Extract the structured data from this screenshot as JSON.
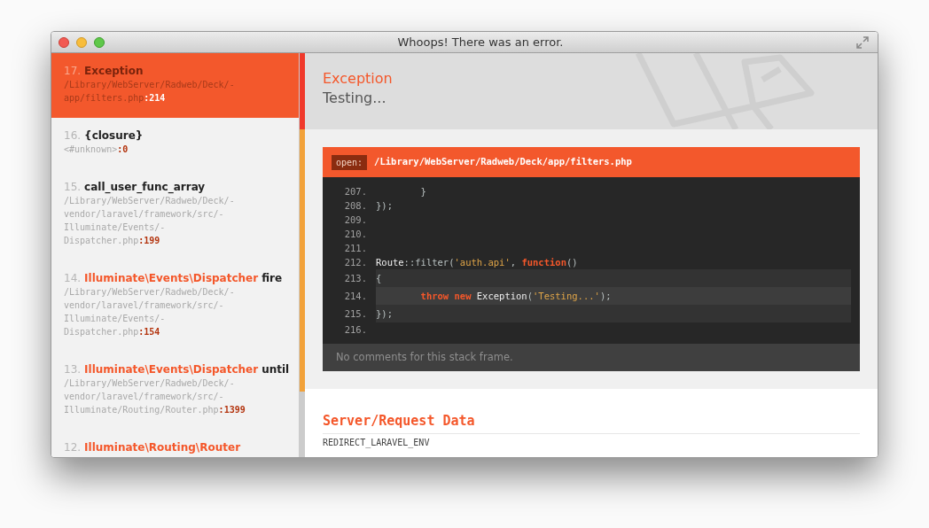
{
  "window": {
    "title": "Whoops! There was an error."
  },
  "frames": [
    {
      "number": "17.",
      "method": "Exception",
      "file": [
        "/Library/WebServer/Radweb/Deck/-",
        "app/filters.php"
      ],
      "line": ":214",
      "selected": true
    },
    {
      "number": "16.",
      "method": "{closure}",
      "file": [
        "<#unknown>"
      ],
      "line": ":0",
      "selected": false
    },
    {
      "number": "15.",
      "method": "call_user_func_array",
      "file": [
        "/Library/WebServer/Radweb/Deck/-",
        "vendor/laravel/framework/src/-",
        "Illuminate/Events/-",
        "Dispatcher.php"
      ],
      "line": ":199",
      "selected": false
    },
    {
      "number": "14.",
      "class": "Illuminate\\Events\\Dispatcher",
      "method": "fire",
      "file": [
        "/Library/WebServer/Radweb/Deck/-",
        "vendor/laravel/framework/src/-",
        "Illuminate/Events/-",
        "Dispatcher.php"
      ],
      "line": ":154",
      "selected": false
    },
    {
      "number": "13.",
      "class": "Illuminate\\Events\\Dispatcher",
      "method": "until",
      "file": [
        "/Library/WebServer/Radweb/Deck/-",
        "vendor/laravel/framework/src/-",
        "Illuminate/Routing/Router.php"
      ],
      "line": ":1399",
      "selected": false
    },
    {
      "number": "12.",
      "class": "Illuminate\\Routing\\Router",
      "selected": false
    }
  ],
  "exception": {
    "type": "Exception",
    "message": "Testing..."
  },
  "code": {
    "open_label": "open:",
    "path": "/Library/WebServer/Radweb/Deck/app/filters.php",
    "lines": [
      {
        "number": "207.",
        "highlighted": false,
        "current": false,
        "tokens": [
          {
            "kind": "plain",
            "text": "        }"
          }
        ]
      },
      {
        "number": "208.",
        "highlighted": false,
        "current": false,
        "tokens": [
          {
            "kind": "plain",
            "text": "});"
          }
        ]
      },
      {
        "number": "209.",
        "highlighted": false,
        "current": false
      },
      {
        "number": "210.",
        "highlighted": false,
        "current": false
      },
      {
        "number": "211.",
        "highlighted": false,
        "current": false
      },
      {
        "number": "212.",
        "highlighted": false,
        "current": false,
        "tokens": [
          {
            "kind": "name",
            "text": "Route"
          },
          {
            "kind": "plain",
            "text": "::filter("
          },
          {
            "kind": "string",
            "text": "'auth.api'"
          },
          {
            "kind": "plain",
            "text": ", "
          },
          {
            "kind": "keyword",
            "text": "function"
          },
          {
            "kind": "plain",
            "text": "()"
          }
        ]
      },
      {
        "number": "213.",
        "highlighted": true,
        "current": false,
        "tokens": [
          {
            "kind": "plain",
            "text": "{"
          }
        ]
      },
      {
        "number": "214.",
        "highlighted": true,
        "current": true,
        "tokens": [
          {
            "kind": "keyword",
            "text": "        throw new"
          },
          {
            "kind": "name",
            "text": " Exception"
          },
          {
            "kind": "plain",
            "text": "("
          },
          {
            "kind": "string",
            "text": "'Testing...'"
          },
          {
            "kind": "plain",
            "text": ");"
          }
        ]
      },
      {
        "number": "215.",
        "highlighted": true,
        "current": false,
        "tokens": [
          {
            "kind": "plain",
            "text": "});"
          }
        ]
      },
      {
        "number": "216.",
        "highlighted": false,
        "current": false
      }
    ],
    "comments": "No comments for this stack frame."
  },
  "server_data": {
    "title": "Server/Request Data",
    "rows": [
      {
        "key": "REDIRECT_LARAVEL_ENV"
      }
    ]
  }
}
